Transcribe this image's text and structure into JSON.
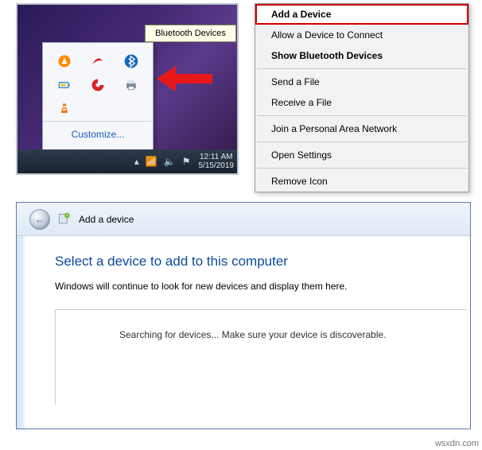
{
  "tray": {
    "tooltip": "Bluetooth Devices",
    "customize": "Customize...",
    "icons": [
      {
        "name": "avast-icon"
      },
      {
        "name": "airtel-icon"
      },
      {
        "name": "bluetooth-icon"
      },
      {
        "name": "battery-icon"
      },
      {
        "name": "ccleaner-icon"
      },
      {
        "name": "printer-icon"
      },
      {
        "name": "vlc-icon"
      }
    ]
  },
  "taskbar": {
    "time": "12:11 AM",
    "date": "5/15/2019"
  },
  "context_menu": {
    "items": [
      {
        "label": "Add a Device",
        "highlight": true
      },
      {
        "label": "Allow a Device to Connect"
      },
      {
        "label": "Show Bluetooth Devices",
        "bold": true
      },
      {
        "sep": true
      },
      {
        "label": "Send a File"
      },
      {
        "label": "Receive a File"
      },
      {
        "sep": true
      },
      {
        "label": "Join a Personal Area Network"
      },
      {
        "sep": true
      },
      {
        "label": "Open Settings"
      },
      {
        "sep": true
      },
      {
        "label": "Remove Icon"
      }
    ]
  },
  "wizard": {
    "title": "Add a device",
    "headline": "Select a device to add to this computer",
    "subtext": "Windows will continue to look for new devices and display them here.",
    "searching": "Searching for devices...  Make sure your device is discoverable."
  },
  "watermark": "wsxdn.com"
}
